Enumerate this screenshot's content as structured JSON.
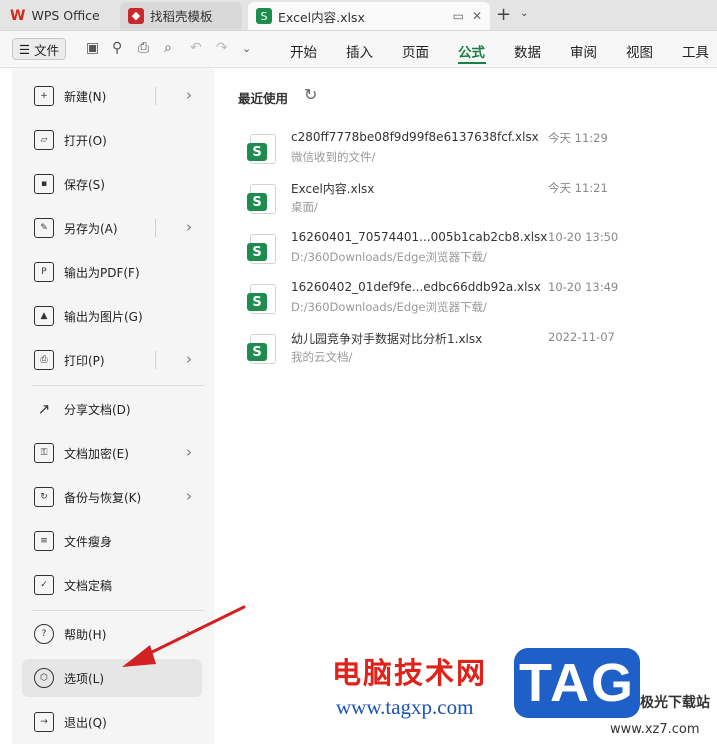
{
  "tabs": [
    {
      "label": "WPS Office",
      "icon": "wps-logo-icon"
    },
    {
      "label": "找稻壳模板",
      "icon": "docer-icon"
    },
    {
      "label": "Excel内容.xlsx",
      "icon": "spreadsheet-icon"
    }
  ],
  "ribbon": {
    "file_label": "文件",
    "tabs": [
      "开始",
      "插入",
      "页面",
      "公式",
      "数据",
      "审阅",
      "视图",
      "工具"
    ],
    "active_tab": "公式"
  },
  "menu": {
    "items": [
      {
        "label": "新建(N)",
        "icon": "new-icon",
        "has_submenu": true
      },
      {
        "label": "打开(O)",
        "icon": "folder-icon",
        "has_submenu": false
      },
      {
        "label": "保存(S)",
        "icon": "save-icon",
        "has_submenu": false
      },
      {
        "label": "另存为(A)",
        "icon": "save-as-icon",
        "has_submenu": true
      },
      {
        "label": "输出为PDF(F)",
        "icon": "pdf-icon",
        "has_submenu": false
      },
      {
        "label": "输出为图片(G)",
        "icon": "image-icon",
        "has_submenu": false
      },
      {
        "label": "打印(P)",
        "icon": "print-icon",
        "has_submenu": true
      },
      {
        "label": "分享文档(D)",
        "icon": "share-icon",
        "has_submenu": false
      },
      {
        "label": "文档加密(E)",
        "icon": "lock-icon",
        "has_submenu": true
      },
      {
        "label": "备份与恢复(K)",
        "icon": "backup-icon",
        "has_submenu": true
      },
      {
        "label": "文件瘦身",
        "icon": "slim-icon",
        "has_submenu": false
      },
      {
        "label": "文档定稿",
        "icon": "finalize-icon",
        "has_submenu": false
      },
      {
        "label": "帮助(H)",
        "icon": "help-icon",
        "has_submenu": true
      },
      {
        "label": "选项(L)",
        "icon": "options-icon",
        "has_submenu": false
      },
      {
        "label": "退出(Q)",
        "icon": "exit-icon",
        "has_submenu": false
      }
    ]
  },
  "recent": {
    "title": "最近使用",
    "files": [
      {
        "name": "c280ff7778be08f9d99f8e6137638fcf.xlsx",
        "path": "微信收到的文件/",
        "time": "今天  11:29"
      },
      {
        "name": "Excel内容.xlsx",
        "path": "桌面/",
        "time": "今天  11:21"
      },
      {
        "name": "16260401_70574401...005b1cab2cb8.xlsx",
        "path": "D:/360Downloads/Edge浏览器下载/",
        "time": "10-20  13:50"
      },
      {
        "name": "16260402_01def9fe...edbc66ddb92a.xlsx",
        "path": "D:/360Downloads/Edge浏览器下载/",
        "time": "10-20  13:49"
      },
      {
        "name": "幼儿园竞争对手数据对比分析1.xlsx",
        "path": "我的云文档/",
        "time": "2022-11-07"
      }
    ]
  },
  "watermark": {
    "site_name": "电脑技术网",
    "site_url": "www.tagxp.com",
    "badge": "TAG",
    "dl_name": "极光下载站",
    "dl_url": "www.xz7.com"
  },
  "colors": {
    "accent": "#1a7f45",
    "annotation": "#d32020"
  }
}
